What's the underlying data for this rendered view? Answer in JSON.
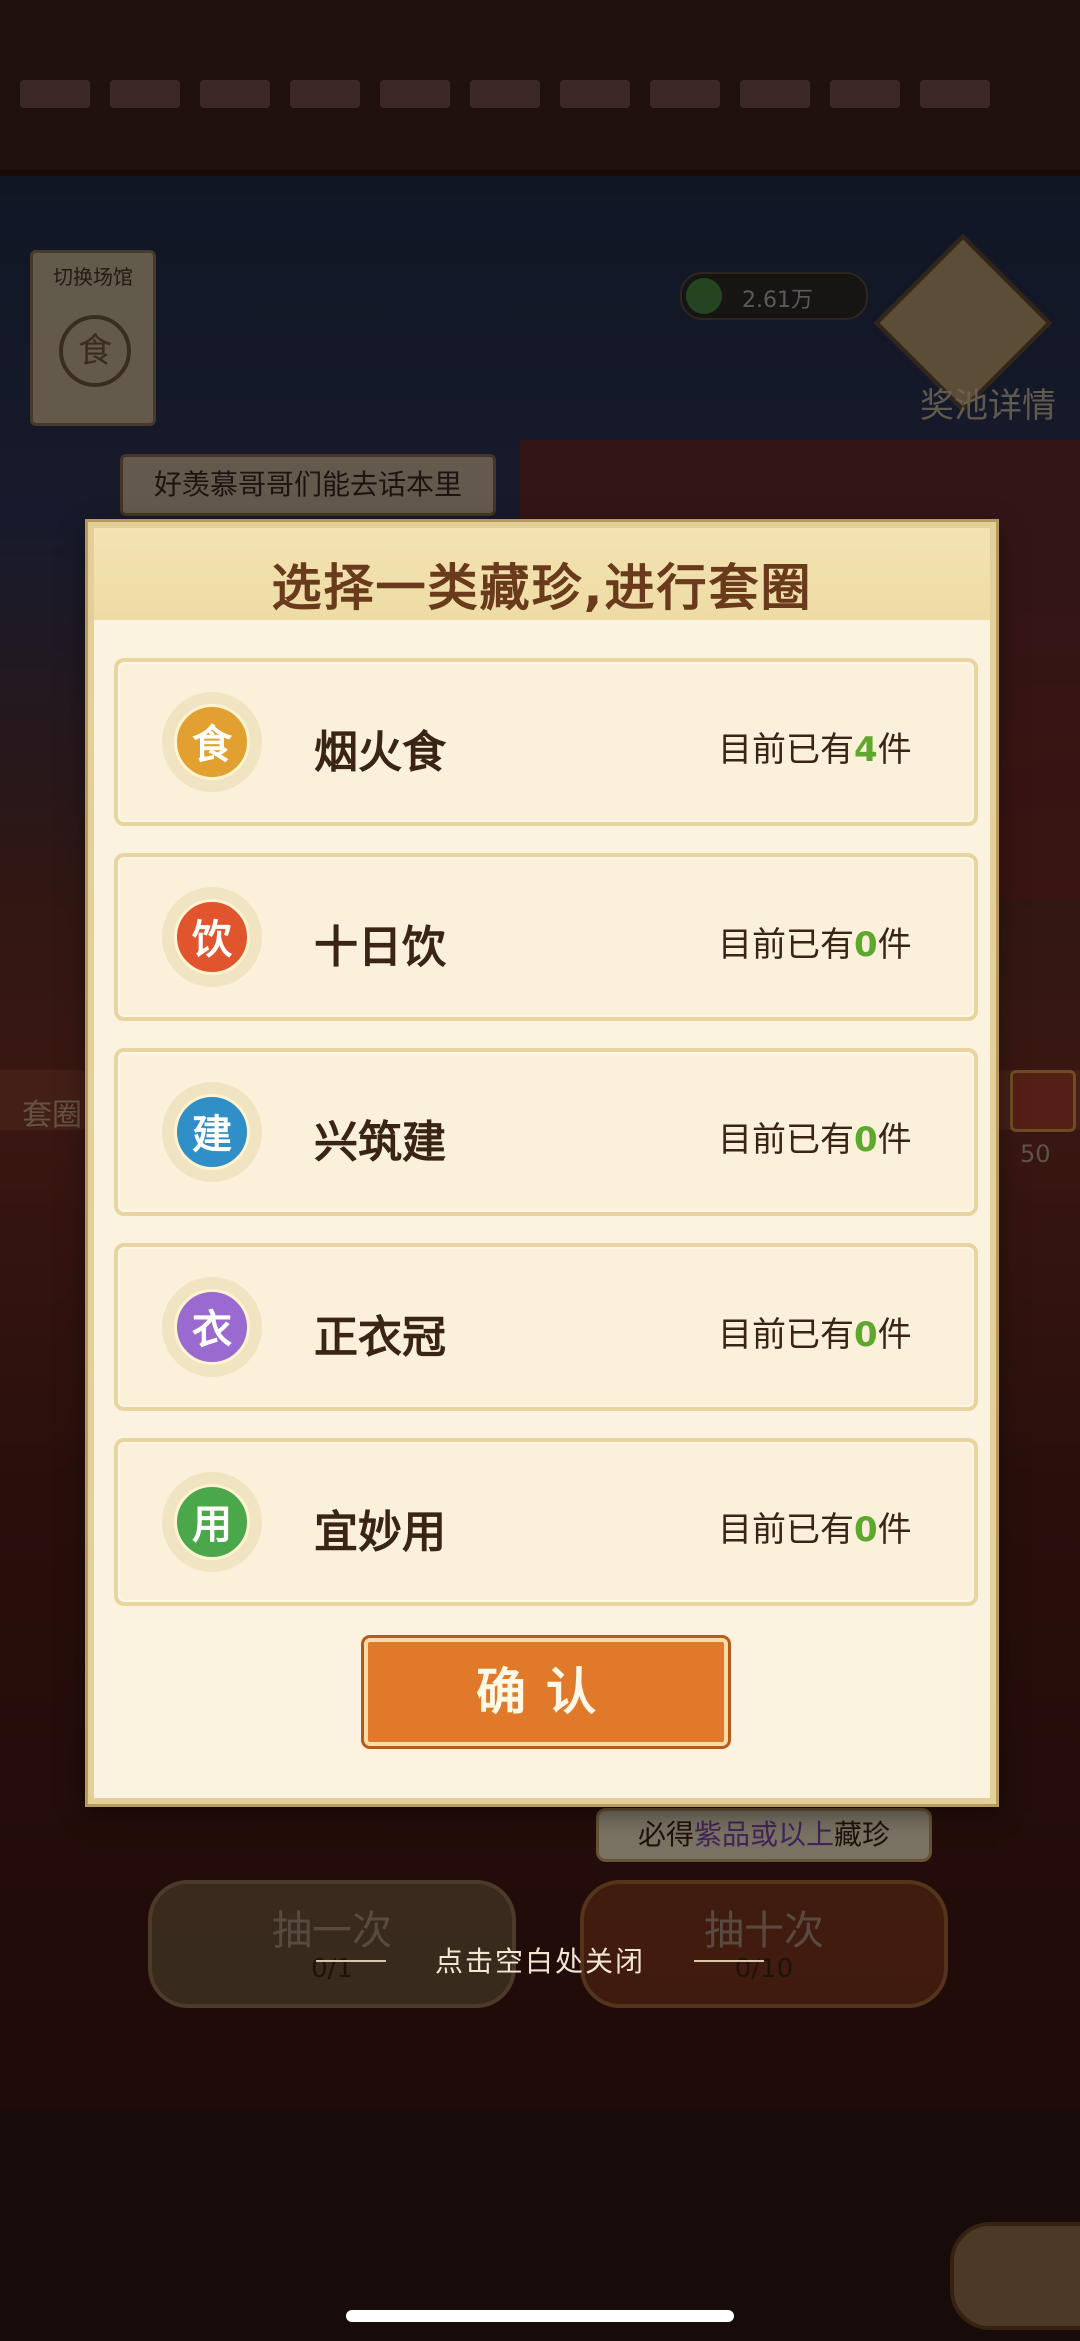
{
  "background": {
    "switch_venue_label": "切换场馆",
    "switch_venue_icon_char": "食",
    "coin_value": "2.61万",
    "pool_detail_label": "奖池详情",
    "comment_text": "好羡慕哥哥们能去话本里",
    "side_label": "套圈",
    "chest_count": "50",
    "draw_one_label": "抽一次",
    "draw_one_progress": "0/1",
    "draw_ten_label": "抽十次",
    "draw_ten_progress": "0/10",
    "guarantee_prefix": "必得",
    "guarantee_highlight": "紫品或以上",
    "guarantee_suffix": "藏珍",
    "close_hint": "点击空白处关闭"
  },
  "dialog": {
    "title": "选择一类藏珍,进行套圈",
    "count_prefix": "目前已有",
    "count_suffix": "件",
    "categories": [
      {
        "icon_char": "食",
        "name": "烟火食",
        "count": "4",
        "color": "#e2a030"
      },
      {
        "icon_char": "饮",
        "name": "十日饮",
        "count": "0",
        "color": "#e0552e"
      },
      {
        "icon_char": "建",
        "name": "兴筑建",
        "count": "0",
        "color": "#2f8fc6"
      },
      {
        "icon_char": "衣",
        "name": "正衣冠",
        "count": "0",
        "color": "#9a6ad0"
      },
      {
        "icon_char": "用",
        "name": "宜妙用",
        "count": "0",
        "color": "#4aa84a"
      }
    ],
    "confirm_label": "确认"
  }
}
